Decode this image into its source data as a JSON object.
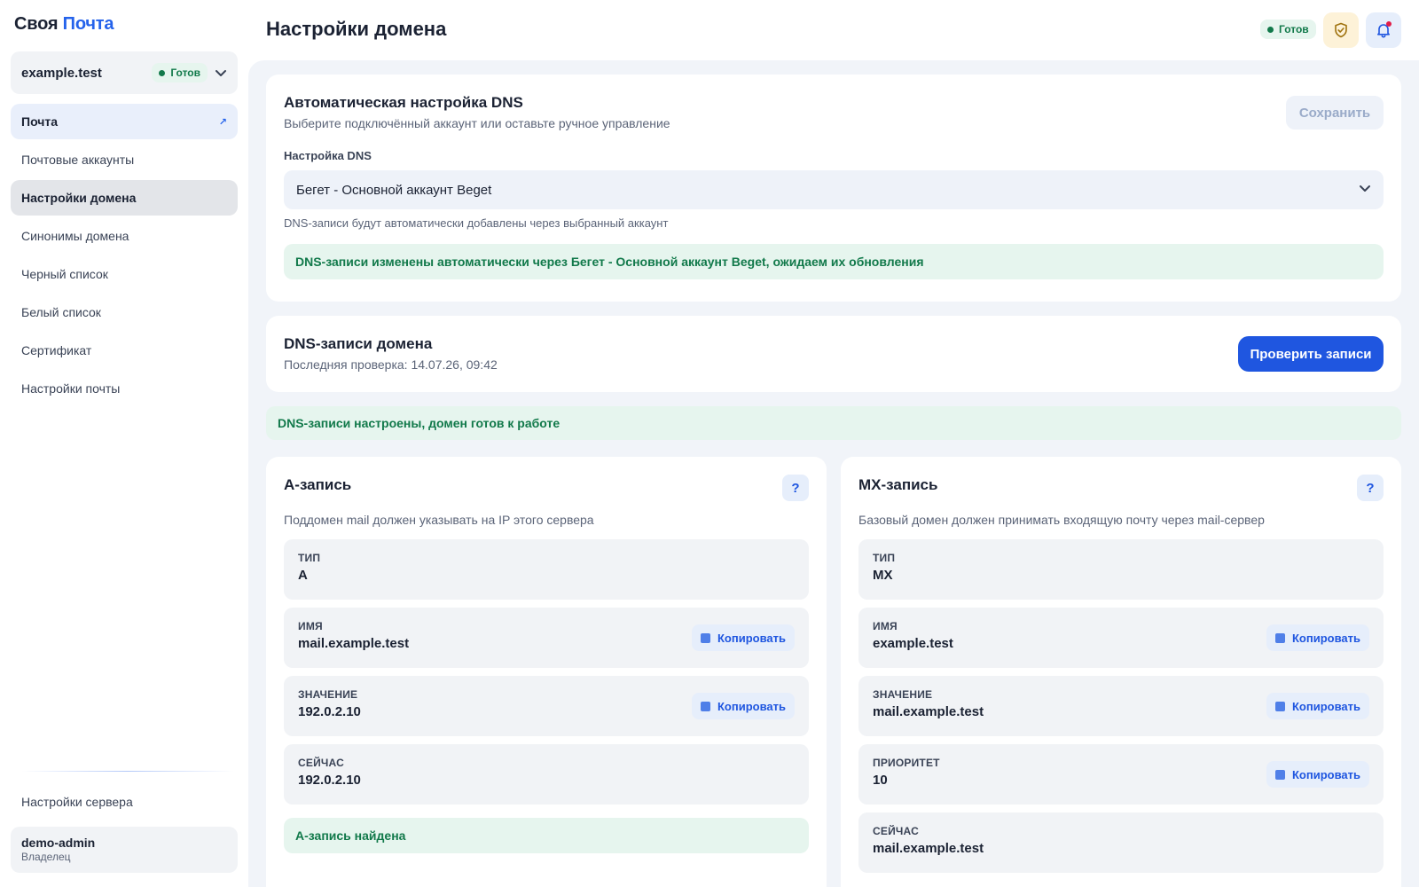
{
  "brand": {
    "part1": "Своя",
    "part2": "Почта"
  },
  "domain_selector": {
    "name": "example.test",
    "status": "Готов"
  },
  "nav": [
    {
      "label": "Почта",
      "icon": "external-arrow-icon"
    },
    {
      "label": "Почтовые аккаунты"
    },
    {
      "label": "Настройки домена"
    },
    {
      "label": "Синонимы домена"
    },
    {
      "label": "Черный список"
    },
    {
      "label": "Белый список"
    },
    {
      "label": "Сертификат"
    },
    {
      "label": "Настройки почты"
    }
  ],
  "server_settings": "Настройки сервера",
  "user": {
    "name": "demo-admin",
    "role": "Владелец"
  },
  "header": {
    "title": "Настройки домена",
    "status": "Готов"
  },
  "dns_auto": {
    "title": "Автоматическая настройка DNS",
    "subtitle": "Выберите подключённый аккаунт или оставьте ручное управление",
    "save_label": "Сохранить",
    "field_label": "Настройка DNS",
    "selected": "Бегет - Основной аккаунт Beget",
    "hint": "DNS-записи будут автоматически добавлены через выбранный аккаунт",
    "notice": "DNS-записи изменены автоматически через Бегет - Основной аккаунт Beget, ожидаем их обновления"
  },
  "dns_records": {
    "title": "DNS-записи домена",
    "last_check": "Последняя проверка: 14.07.26, 09:42",
    "check_label": "Проверить записи",
    "ready_banner": "DNS-записи настроены, домен готов к работе"
  },
  "copy_label": "Копировать",
  "a_record": {
    "title": "А-запись",
    "help": "?",
    "desc": "Поддомен mail должен указывать на IP этого сервера",
    "fields": [
      {
        "label": "ТИП",
        "value": "A"
      },
      {
        "label": "ИМЯ",
        "value": "mail.example.test"
      },
      {
        "label": "ЗНАЧЕНИЕ",
        "value": "192.0.2.10"
      },
      {
        "label": "СЕЙЧАС",
        "value": "192.0.2.10"
      }
    ],
    "found": "А-запись найдена"
  },
  "mx_record": {
    "title": "MX-запись",
    "help": "?",
    "desc": "Базовый домен должен принимать входящую почту через mail-сервер",
    "fields": [
      {
        "label": "ТИП",
        "value": "MX"
      },
      {
        "label": "ИМЯ",
        "value": "example.test"
      },
      {
        "label": "ЗНАЧЕНИЕ",
        "value": "mail.example.test"
      },
      {
        "label": "ПРИОРИТЕТ",
        "value": "10"
      },
      {
        "label": "СЕЙЧАС",
        "value": "mail.example.test"
      }
    ]
  },
  "colors": {
    "accent": "#1f56e0",
    "success": "#11794a",
    "success_bg": "#e6f5ee"
  }
}
